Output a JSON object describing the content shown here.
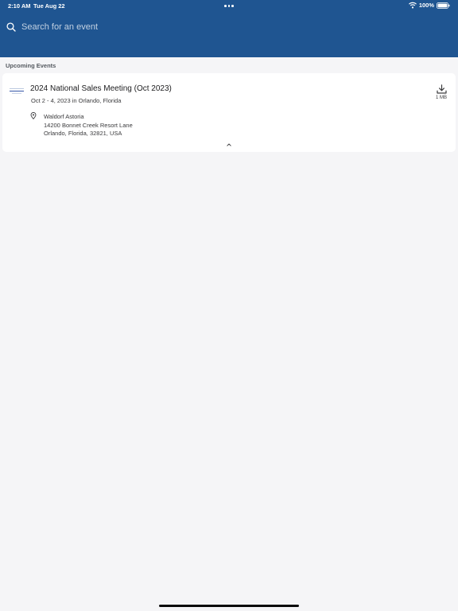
{
  "status_bar": {
    "time": "2:10 AM",
    "date": "Tue Aug 22",
    "battery": "100%"
  },
  "search": {
    "placeholder": "Search for an event"
  },
  "section": {
    "title": "Upcoming Events"
  },
  "events": [
    {
      "title": "2024 National Sales Meeting (Oct 2023)",
      "dates": "Oct 2 - 4, 2023 in Orlando, Florida",
      "venue_name": "Waldorf Astoria",
      "address_line1": "14200 Bonnet Creek Resort Lane",
      "address_line2": "Orlando, Florida, 32821, USA",
      "download_size": "1 MB"
    }
  ],
  "icons": {
    "search": "search-icon",
    "location": "location-pin-icon",
    "download": "download-icon",
    "collapse": "chevron-up-icon",
    "wifi": "wifi-icon",
    "battery": "battery-icon"
  },
  "colors": {
    "header_bg": "#1f5591",
    "page_bg": "#f5f5f7",
    "card_bg": "#ffffff"
  }
}
